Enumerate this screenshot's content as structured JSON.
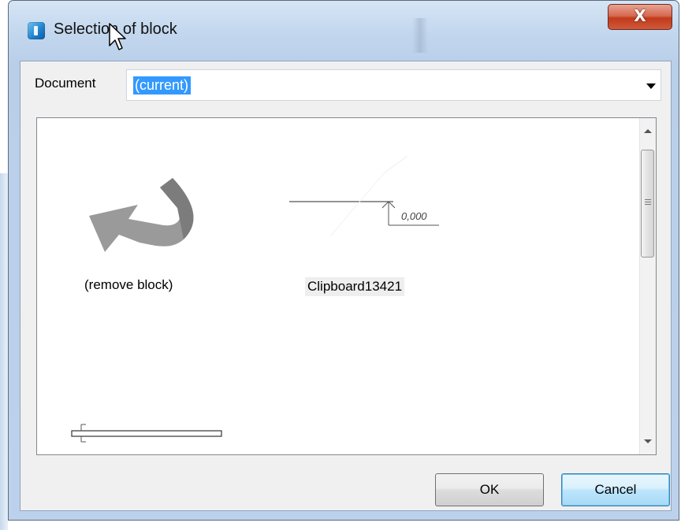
{
  "window": {
    "title": "Selection of block",
    "close_label": "X"
  },
  "document": {
    "label": "Document",
    "selected_value": "(current)"
  },
  "gallery": {
    "items": [
      {
        "caption": "(remove block)",
        "icon": "remove-block-arrow-icon"
      },
      {
        "caption": "Clipboard13421",
        "icon": "level-mark-block-preview",
        "dimension_text": "0,000"
      },
      {
        "caption": "",
        "icon": "section-block-preview"
      }
    ]
  },
  "buttons": {
    "ok": "OK",
    "cancel": "Cancel"
  },
  "colors": {
    "selection": "#3399ff",
    "close_button": "#c9472a",
    "window_frame": "#c3d7ee"
  }
}
